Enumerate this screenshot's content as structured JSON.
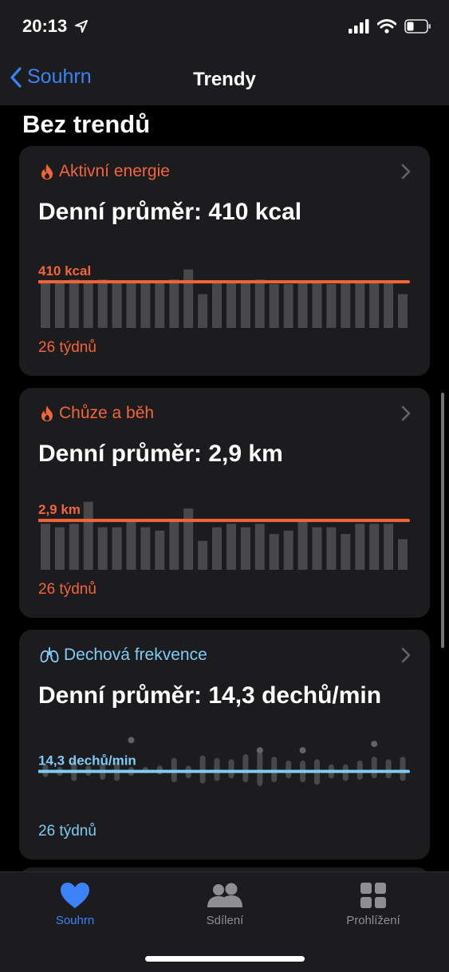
{
  "status": {
    "time": "20:13",
    "battery_level": 0.35
  },
  "nav": {
    "back_label": "Souhrn",
    "title": "Trendy"
  },
  "section_title": "Bez trendů",
  "cards": [
    {
      "title": "Aktivní energie",
      "value_text": "Denní průměr: 410 kcal",
      "avg_label": "410 kcal",
      "footer": "26 týdnů",
      "accent": "#f2653a",
      "icon": "flame-icon",
      "chart_data": {
        "type": "bar",
        "average": 410,
        "ylim": [
          0,
          680
        ],
        "values": [
          410,
          410,
          430,
          410,
          430,
          410,
          410,
          410,
          410,
          430,
          520,
          300,
          410,
          410,
          410,
          430,
          390,
          390,
          410,
          410,
          390,
          410,
          410,
          410,
          410,
          300
        ]
      }
    },
    {
      "title": "Chůze a běh",
      "value_text": "Denní průměr: 2,9 km",
      "avg_label": "2,9 km",
      "footer": "26 týdnů",
      "accent": "#f2653a",
      "icon": "flame-icon",
      "chart_data": {
        "type": "bar",
        "average": 2.9,
        "ylim": [
          0,
          4.5
        ],
        "values": [
          2.7,
          2.5,
          2.7,
          4.0,
          2.5,
          2.5,
          2.9,
          2.5,
          2.3,
          3.0,
          3.6,
          1.7,
          2.5,
          2.7,
          2.5,
          2.7,
          2.1,
          2.3,
          2.9,
          2.5,
          2.5,
          2.1,
          2.7,
          2.7,
          2.7,
          1.8
        ]
      }
    },
    {
      "title": "Dechová frekvence",
      "value_text": "Denní průměr: 14,3 dechů/min",
      "avg_label": "14,3 dechů/min",
      "footer": "26 týdnů",
      "accent": "#7ecbf5",
      "icon": "lungs-icon",
      "chart_data": {
        "type": "range",
        "average": 14.3,
        "ylim": [
          8,
          20
        ],
        "ranges": [
          [
            13.4,
            15.4
          ],
          [
            13.6,
            15.0
          ],
          [
            12.8,
            16.0
          ],
          [
            13.6,
            15.2
          ],
          [
            13.0,
            15.6
          ],
          [
            12.8,
            15.8
          ],
          [
            13.6,
            15.0
          ],
          [
            14.0,
            15.0
          ],
          [
            13.8,
            15.2
          ],
          [
            12.6,
            16.4
          ],
          [
            13.2,
            15.2
          ],
          [
            12.4,
            16.8
          ],
          [
            12.8,
            16.4
          ],
          [
            13.2,
            16.2
          ],
          [
            12.6,
            17.0
          ],
          [
            12.0,
            17.4
          ],
          [
            12.6,
            16.6
          ],
          [
            13.2,
            16.0
          ],
          [
            12.6,
            16.0
          ],
          [
            12.2,
            16.2
          ],
          [
            13.2,
            15.4
          ],
          [
            12.8,
            15.4
          ],
          [
            13.0,
            16.0
          ],
          [
            13.2,
            16.6
          ],
          [
            13.2,
            16.2
          ],
          [
            12.8,
            16.6
          ]
        ],
        "dots": [
          {
            "index": 6,
            "value": 19.2
          },
          {
            "index": 15,
            "value": 17.6
          },
          {
            "index": 18,
            "value": 17.6
          },
          {
            "index": 23,
            "value": 18.6
          }
        ]
      }
    }
  ],
  "tabbar": {
    "items": [
      {
        "label": "Souhrn",
        "icon": "heart-icon",
        "active": true
      },
      {
        "label": "Sdílení",
        "icon": "people-icon",
        "active": false
      },
      {
        "label": "Prohlížení",
        "icon": "grid-icon",
        "active": false
      }
    ],
    "active_color": "#3b82f6",
    "inactive_color": "#8e8e93"
  }
}
